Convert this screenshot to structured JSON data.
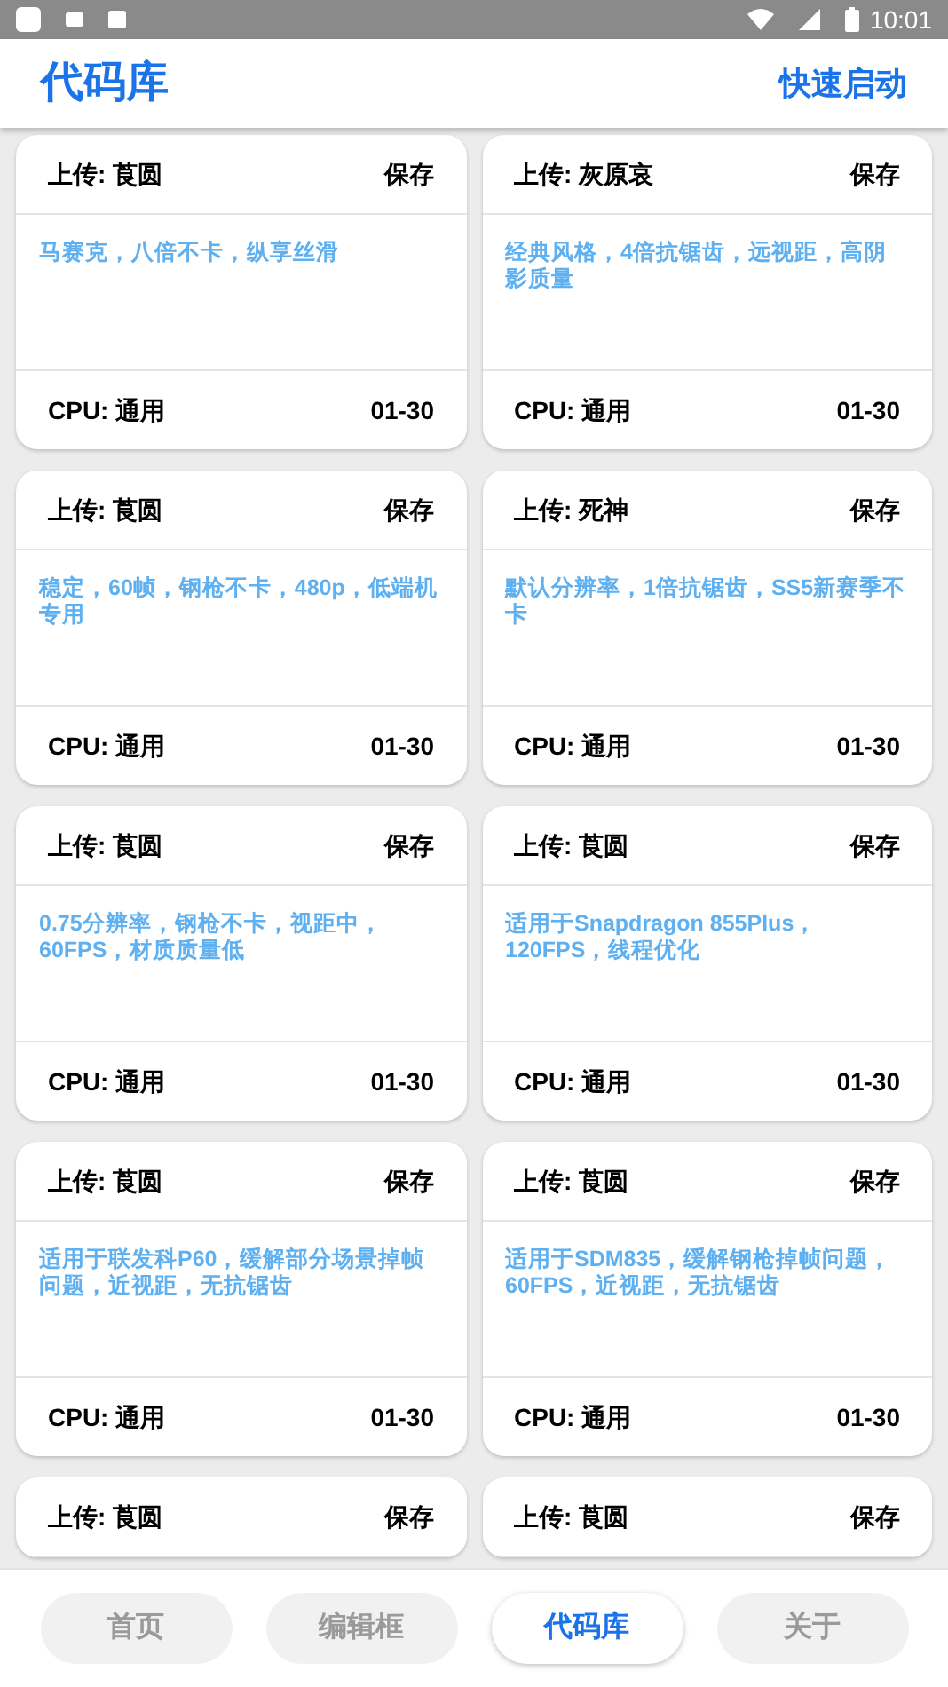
{
  "status_bar": {
    "time": "10:01"
  },
  "header": {
    "title": "代码库",
    "action": "快速启动"
  },
  "columns": [
    {
      "cards": [
        {
          "uploader": "上传: 莨圆",
          "save": "保存",
          "description": "马赛克，八倍不卡，纵享丝滑",
          "cpu": "CPU: 通用",
          "date": "01-30"
        },
        {
          "uploader": "上传: 莨圆",
          "save": "保存",
          "description": "稳定，60帧，钢枪不卡，480p，低端机专用",
          "cpu": "CPU: 通用",
          "date": "01-30"
        },
        {
          "uploader": "上传: 莨圆",
          "save": "保存",
          "description": "0.75分辨率，钢枪不卡，视距中，60FPS，材质质量低",
          "cpu": "CPU: 通用",
          "date": "01-30"
        },
        {
          "uploader": "上传: 莨圆",
          "save": "保存",
          "description": "适用于联发科P60，缓解部分场景掉帧问题，近视距，无抗锯齿",
          "cpu": "CPU: 通用",
          "date": "01-30"
        },
        {
          "uploader": "上传: 莨圆",
          "save": "保存"
        }
      ]
    },
    {
      "cards": [
        {
          "uploader": "上传: 灰原哀",
          "save": "保存",
          "description": "经典风格，4倍抗锯齿，远视距，高阴影质量",
          "cpu": "CPU: 通用",
          "date": "01-30"
        },
        {
          "uploader": "上传: 死神",
          "save": "保存",
          "description": "默认分辨率，1倍抗锯齿，SS5新赛季不卡",
          "cpu": "CPU: 通用",
          "date": "01-30"
        },
        {
          "uploader": "上传: 莨圆",
          "save": "保存",
          "description": "适用于Snapdragon 855Plus，120FPS，线程优化",
          "cpu": "CPU: 通用",
          "date": "01-30"
        },
        {
          "uploader": "上传: 莨圆",
          "save": "保存",
          "description": "适用于SDM835，缓解钢枪掉帧问题，60FPS，近视距，无抗锯齿",
          "cpu": "CPU: 通用",
          "date": "01-30"
        },
        {
          "uploader": "上传: 莨圆",
          "save": "保存"
        }
      ]
    }
  ],
  "bottom_nav": [
    {
      "label": "首页",
      "selected": false
    },
    {
      "label": "编辑框",
      "selected": false
    },
    {
      "label": "代码库",
      "selected": true
    },
    {
      "label": "关于",
      "selected": false
    }
  ]
}
